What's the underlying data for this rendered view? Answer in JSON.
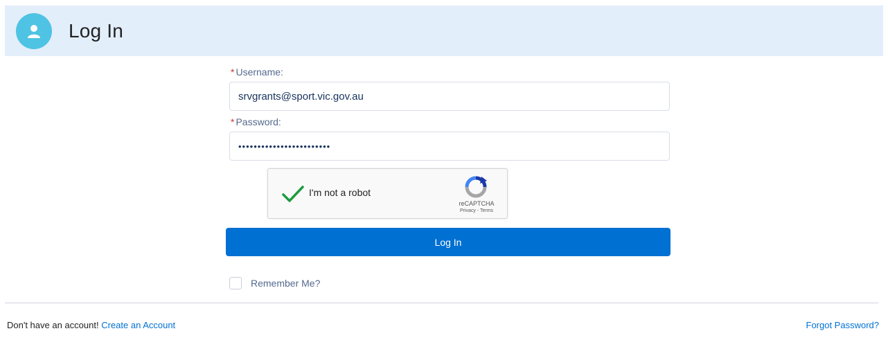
{
  "header": {
    "title": "Log In"
  },
  "form": {
    "username_label": "Username:",
    "username_value": "srvgrants@sport.vic.gov.au",
    "password_label": "Password:",
    "password_value": "••••••••••••••••••••••••",
    "required_marker": "*"
  },
  "captcha": {
    "label": "I'm not a robot",
    "brand": "reCAPTCHA",
    "links": "Privacy - Terms",
    "checked": true
  },
  "login_button_label": "Log In",
  "remember": {
    "label": "Remember Me?",
    "checked": false
  },
  "footer": {
    "no_account_text": "Don't have an account!",
    "create_account_link": "Create an Account",
    "forgot_password_link": "Forgot Password?"
  },
  "colors": {
    "header_bg": "#e3eefb",
    "avatar": "#4fc3e3",
    "primary_button": "#0070d2",
    "link": "#0070d2",
    "required": "#c23934"
  }
}
